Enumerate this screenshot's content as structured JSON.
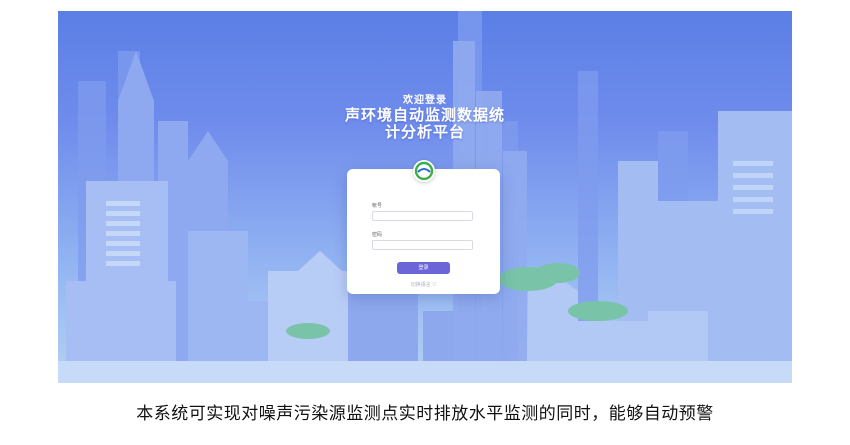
{
  "login": {
    "welcome": "欢迎登录",
    "title_line1": "声环境自动监测数据统",
    "title_line2": "计分析平台",
    "account_label": "帐号",
    "password_label": "密码",
    "login_button": "登录",
    "switch_link": "切换语言 ▽"
  },
  "caption": "本系统可实现对噪声污染源监测点实时排放水平监测的同时，能够自动预警",
  "colors": {
    "sky_top": "#5b7fe6",
    "button": "#6b65d8",
    "logo_green": "#3fae4a",
    "logo_blue": "#2a6bd1"
  }
}
